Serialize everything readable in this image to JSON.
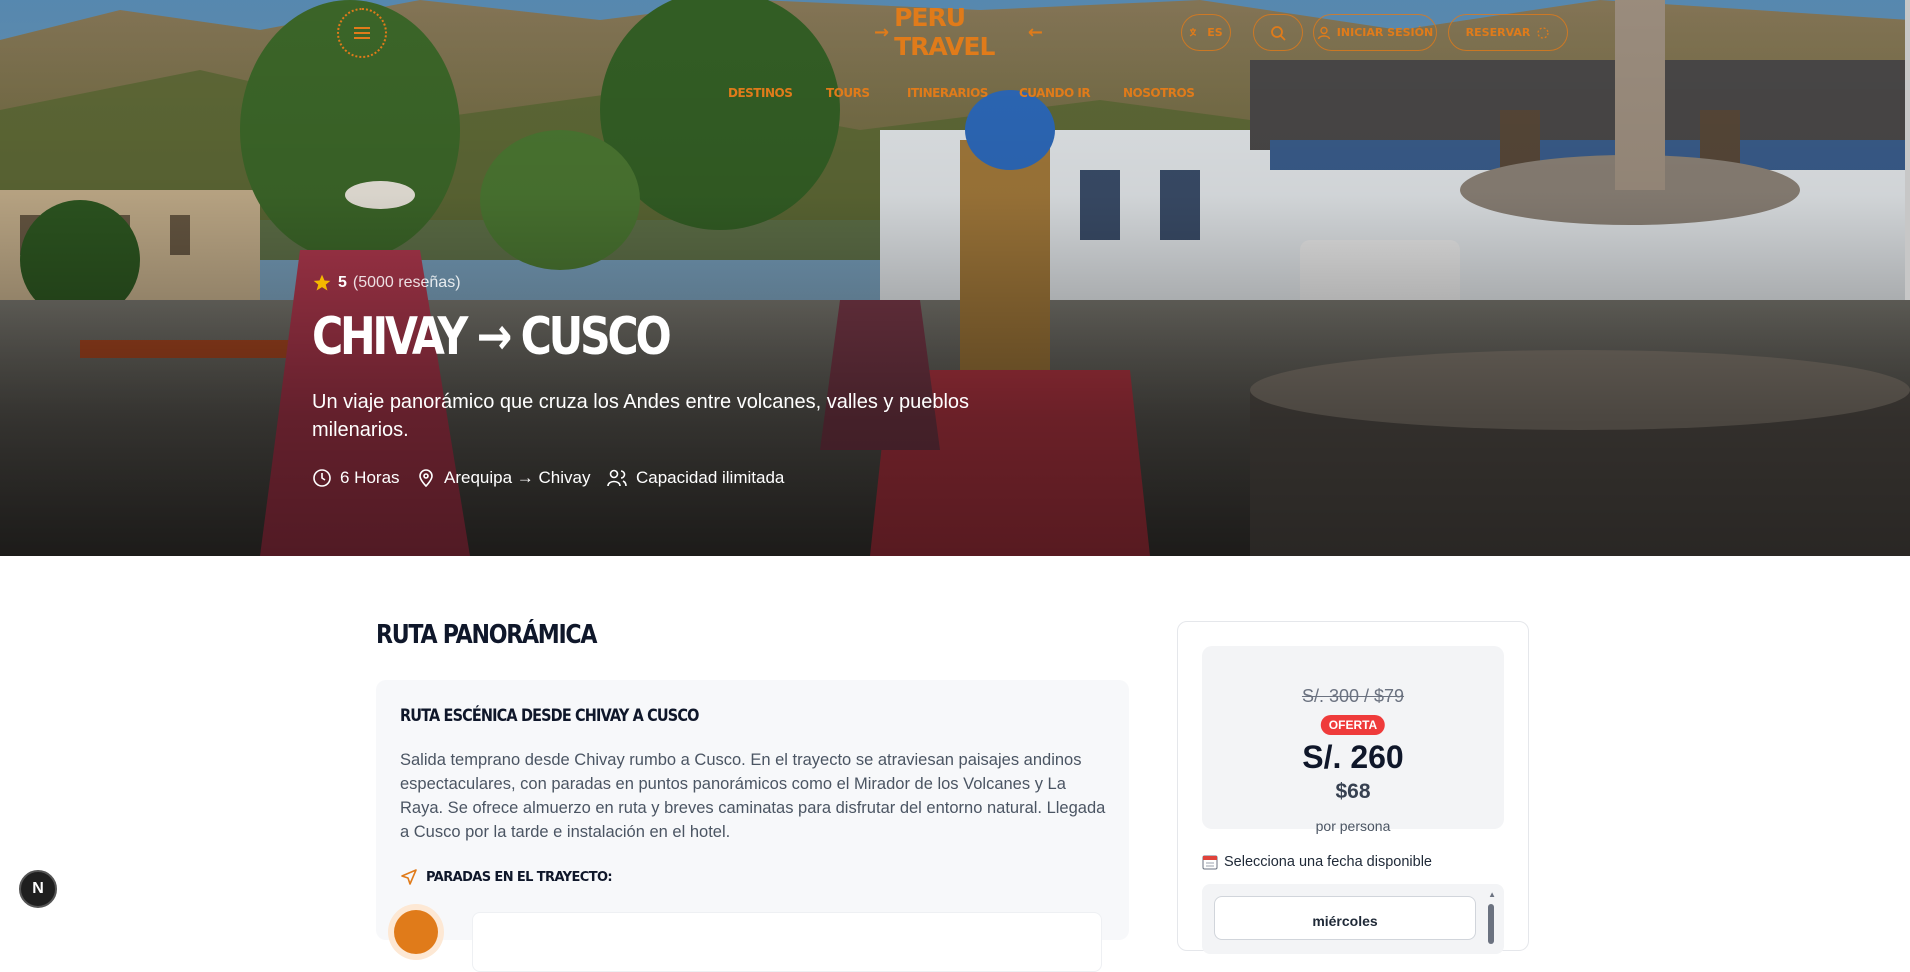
{
  "header": {
    "brand": "PERU TRAVEL",
    "brand_left_arrow": "→",
    "brand_right_arrow": "←",
    "lang_label": "ES",
    "login_label": "INICIAR SESIÓN",
    "reserve_label": "RESERVAR",
    "nav": [
      "DESTINOS",
      "TOURS",
      "ITINERARIOS",
      "CUANDO IR",
      "NOSOTROS"
    ]
  },
  "hero": {
    "rating_value": "5",
    "reviews": "(5000 reseñas)",
    "title": "CHIVAY → CUSCO",
    "subtitle": "Un viaje panorámico que cruza los Andes entre volcanes, valles y pueblos milenarios.",
    "duration": "6 Horas",
    "route": "Arequipa → Chivay",
    "capacity": "Capacidad ilimitada"
  },
  "main": {
    "section_title": "RUTA PANORÁMICA",
    "card_title": "RUTA ESCÉNICA DESDE CHIVAY A CUSCO",
    "card_description": "Salida temprano desde Chivay rumbo a Cusco. En el trayecto se atraviesan paisajes andinos espectaculares, con paradas en puntos panorámicos como el Mirador de los Volcanes y La Raya. Se ofrece almuerzo en ruta y breves caminatas para disfrutar del entorno natural. Llegada a Cusco por la tarde e instalación en el hotel.",
    "stops_label": "PARADAS EN EL TRAYECTO:"
  },
  "pricing": {
    "old_price": "S/. 300 / $79",
    "badge": "OFERTA",
    "price_pen": "S/. 260",
    "price_usd": "$68",
    "per_person": "por persona",
    "date_label": "Selecciona una fecha disponible",
    "first_date": "miércoles"
  },
  "fab_label": "N",
  "colors": {
    "accent": "#e07b1a",
    "offer": "#ef3b3b",
    "dark": "#0f172a"
  }
}
